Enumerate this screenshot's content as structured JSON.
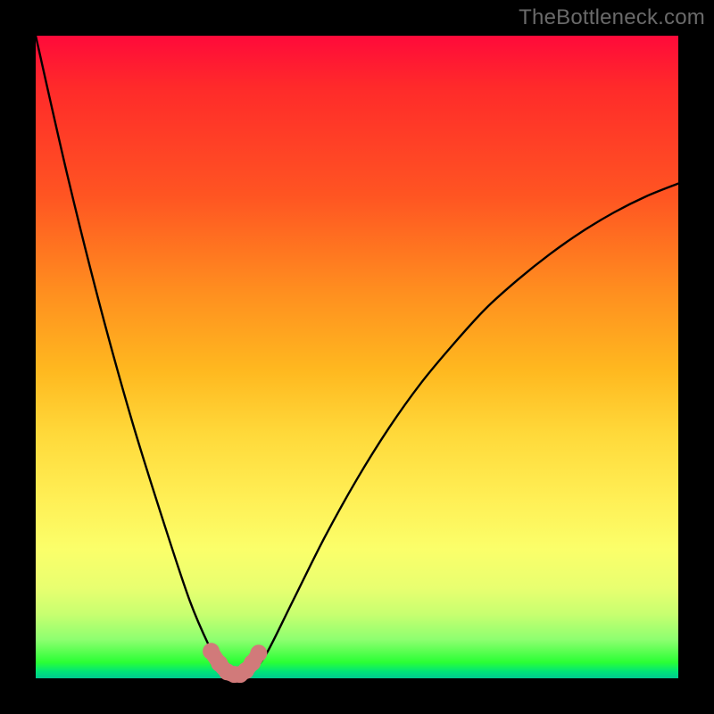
{
  "watermark": "TheBottleneck.com",
  "colors": {
    "frame": "#000000",
    "curve": "#000000",
    "marker_fill": "#d17a7a",
    "marker_stroke": "#b85b5b",
    "watermark": "#6a6a6a"
  },
  "chart_data": {
    "type": "line",
    "title": "",
    "xlabel": "",
    "ylabel": "",
    "xlim": [
      0,
      100
    ],
    "ylim": [
      0,
      100
    ],
    "grid": false,
    "legend": false,
    "series": [
      {
        "name": "bottleneck-curve",
        "x": [
          0,
          5,
          10,
          15,
          20,
          24,
          27,
          29,
          30.5,
          32,
          34,
          36,
          40,
          45,
          50,
          55,
          60,
          65,
          70,
          75,
          80,
          85,
          90,
          95,
          100
        ],
        "y": [
          100,
          78,
          58,
          40,
          24,
          12,
          5,
          1.5,
          0.5,
          0.5,
          1.5,
          4,
          12,
          22,
          31,
          39,
          46,
          52,
          57.5,
          62,
          66,
          69.5,
          72.5,
          75,
          77
        ]
      }
    ],
    "markers": {
      "name": "trough-markers",
      "x": [
        27.3,
        28.6,
        29.8,
        30.9,
        31.8,
        32.7,
        33.7,
        34.7
      ],
      "y": [
        4.2,
        2.3,
        1.0,
        0.6,
        0.6,
        1.2,
        2.4,
        3.9
      ]
    }
  }
}
